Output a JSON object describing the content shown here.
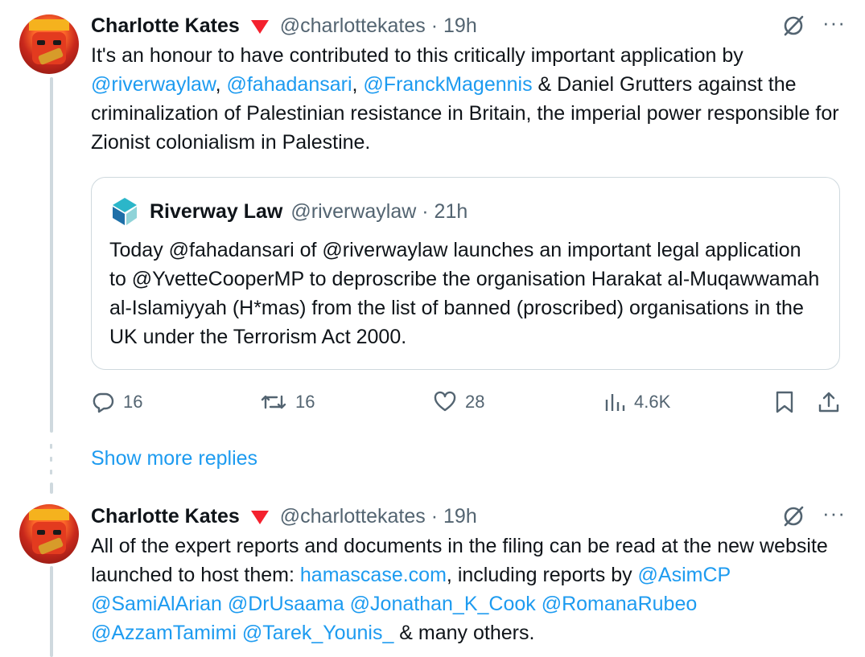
{
  "tweet1": {
    "name": "Charlotte Kates",
    "handle": "@charlottekates",
    "time": "19h",
    "more": "···",
    "text_parts": [
      "It's an honour to have contributed to this critically important application by",
      "@riverwaylaw",
      ", ",
      "@fahadansari",
      ", ",
      "@FranckMagennis",
      " & Daniel Grutters against the criminalization of Palestinian resistance in Britain, the imperial power responsible for Zionist colonialism in Palestine."
    ],
    "quote": {
      "name": "Riverway Law",
      "handle": "@riverwaylaw",
      "time": "21h",
      "text": "Today @fahadansari of @riverwaylaw launches an important legal application to @YvetteCooperMP to deproscribe the organisation Harakat al-Muqawwamah al-Islamiyyah (H*mas) from the list of banned (proscribed) organisations in the UK under the Terrorism Act 2000."
    },
    "stats": {
      "replies": "16",
      "reposts": "16",
      "likes": "28",
      "views": "4.6K"
    }
  },
  "show_more": "Show more replies",
  "tweet2": {
    "name": "Charlotte Kates",
    "handle": "@charlottekates",
    "time": "19h",
    "more": "···",
    "text_parts": [
      "All of the expert reports and documents in the filing can be read at the new website launched to host them: ",
      "hamascase.com",
      ", including reports by ",
      "@AsimCP @SamiAlArian @DrUsaama @Jonathan_K_Cook @RomanaRubeo @AzzamTamimi @Tarek_Younis_",
      " & many others."
    ]
  },
  "colors": {
    "accent": "#1d9bf0",
    "muted": "#536471",
    "badge": "#f4212e",
    "border": "#cfd9de"
  },
  "icons": [
    "grok-icon",
    "more-icon",
    "reply-icon",
    "repost-icon",
    "like-icon",
    "views-icon",
    "bookmark-icon",
    "share-icon"
  ]
}
